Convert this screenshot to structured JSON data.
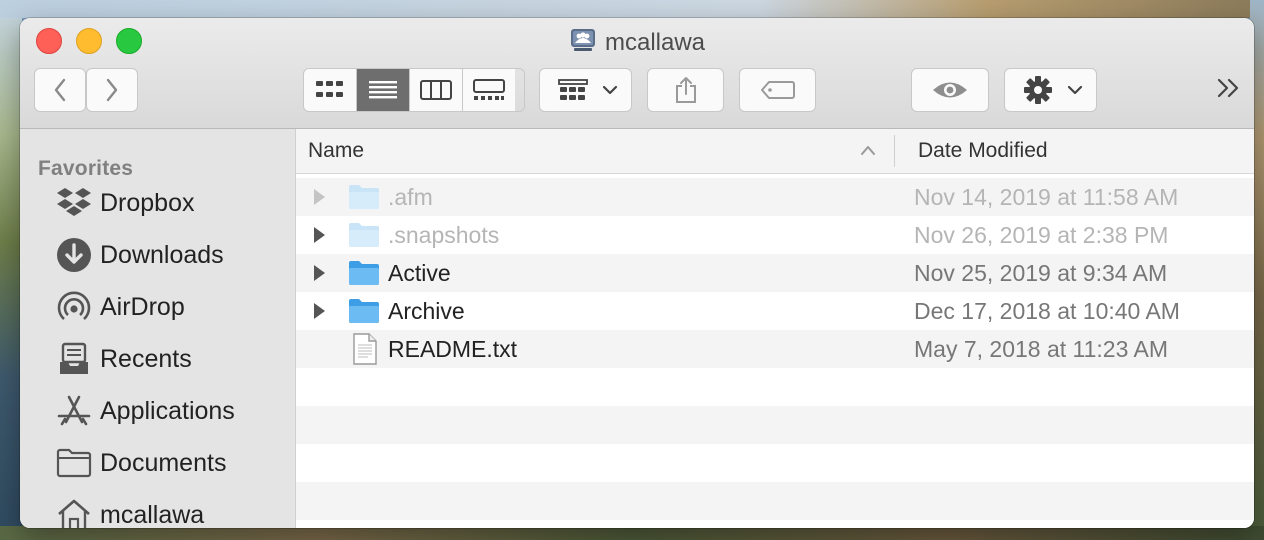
{
  "window": {
    "title": "mcallawa"
  },
  "toolbar": {
    "back": "back",
    "forward": "forward",
    "views": [
      "icon-view",
      "list-view",
      "column-view",
      "gallery-view"
    ],
    "active_view": "list-view",
    "group": "group-by",
    "share": "share",
    "tags": "tags",
    "quicklook": "quick-look",
    "action": "action",
    "overflow": "»"
  },
  "sidebar": {
    "section": "Favorites",
    "items": [
      {
        "label": "Dropbox",
        "icon": "dropbox-icon"
      },
      {
        "label": "Downloads",
        "icon": "download-icon"
      },
      {
        "label": "AirDrop",
        "icon": "airdrop-icon"
      },
      {
        "label": "Recents",
        "icon": "recents-icon"
      },
      {
        "label": "Applications",
        "icon": "applications-icon"
      },
      {
        "label": "Documents",
        "icon": "folder-icon"
      },
      {
        "label": "mcallawa",
        "icon": "home-icon"
      }
    ]
  },
  "columns": {
    "name": "Name",
    "date": "Date Modified"
  },
  "files": [
    {
      "name": ".afm",
      "date": "Nov 14, 2019 at 11:58 AM",
      "type": "folder",
      "hidden": true
    },
    {
      "name": ".snapshots",
      "date": "Nov 26, 2019 at 2:38 PM",
      "type": "folder",
      "hidden": true
    },
    {
      "name": "Active",
      "date": "Nov 25, 2019 at 9:34 AM",
      "type": "folder",
      "hidden": false
    },
    {
      "name": "Archive",
      "date": "Dec 17, 2018 at 10:40 AM",
      "type": "folder",
      "hidden": false
    },
    {
      "name": "README.txt",
      "date": "May 7, 2018 at 11:23 AM",
      "type": "file",
      "hidden": false
    }
  ]
}
